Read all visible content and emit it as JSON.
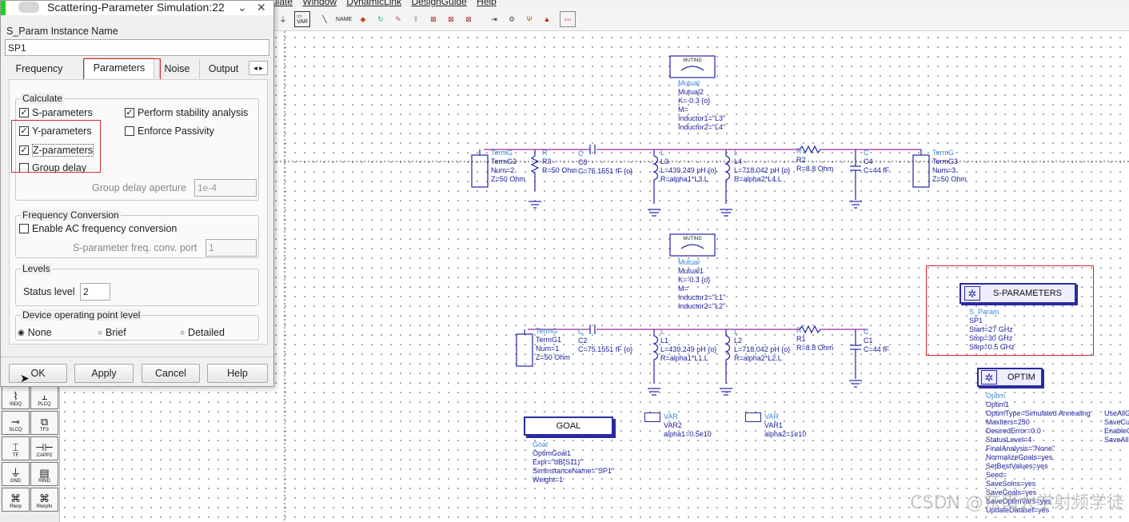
{
  "menubar": {
    "items": [
      "ulate",
      "Window",
      "DynamicLink",
      "DesignGuide",
      "Help"
    ]
  },
  "dialog": {
    "title": "Scattering-Parameter Simulation:22",
    "instance_label": "S_Param Instance Name",
    "instance_value": "SP1",
    "tabs": [
      "Frequency",
      "Parameters",
      "Noise",
      "Output"
    ],
    "calculate": {
      "legend": "Calculate",
      "s_params": "S-parameters",
      "y_params": "Y-parameters",
      "z_params": "Z-parameters",
      "group_delay": "Group delay",
      "stability": "Perform stability analysis",
      "passivity": "Enforce Passivity",
      "gd_aperture_label": "Group delay aperture",
      "gd_aperture_value": "1e-4"
    },
    "freq_conv": {
      "legend": "Frequency Conversion",
      "enable": "Enable AC frequency conversion",
      "port_label": "S-parameter freq. conv. port",
      "port_value": "1"
    },
    "levels": {
      "legend": "Levels",
      "status_label": "Status level",
      "status_value": "2"
    },
    "devop": {
      "legend": "Device operating point level",
      "none": "None",
      "brief": "Brief",
      "detailed": "Detailed"
    },
    "buttons": {
      "ok": "OK",
      "apply": "Apply",
      "cancel": "Cancel",
      "help": "Help"
    }
  },
  "palette": [
    "INDQ",
    "PLCQ",
    "SLCQ",
    "TF3",
    "TF",
    "CAPP2",
    "GND",
    "RIND",
    "Rterp",
    "Rterpfn"
  ],
  "schematic": {
    "mutual2": [
      "MUTIND",
      "Mutual",
      "Mutual2",
      "K=-0.3 {o}",
      "M=",
      "Inductor1=\"L3\"",
      "Inductor2=\"L4\""
    ],
    "mutual1": [
      "MUTIND",
      "Mutual",
      "Mutual1",
      "K=-0.3 {o}",
      "M=",
      "Inductor1=\"L1\"",
      "Inductor2=\"L2\""
    ],
    "termg2": [
      "TermG",
      "TermG2",
      "Num=2",
      "Z=50 Ohm"
    ],
    "termg3": [
      "TermG",
      "TermG3",
      "Num=3",
      "Z=50 Ohm"
    ],
    "termg1": [
      "TermG",
      "TermG1",
      "Num=1",
      "Z=50 Ohm"
    ],
    "r3": [
      "R",
      "R3",
      "R=50 Ohm"
    ],
    "c3": [
      "C",
      "C3",
      "C=75.1551 fF {o}"
    ],
    "c2": [
      "C",
      "C2",
      "C=75.1551 fF {o}"
    ],
    "l3": [
      "L",
      "L3",
      "L=439.249 pH {o}",
      "R=alpha1*L3.L"
    ],
    "l4": [
      "L",
      "L4",
      "L=718.042 pH {o}",
      "R=alpha2*L4.L"
    ],
    "l1": [
      "L",
      "L1",
      "L=439.249 pH {o}",
      "R=alpha1*L1.L"
    ],
    "l2": [
      "L",
      "L2",
      "L=718.042 pH {o}",
      "R=alpha2*L2.L"
    ],
    "r2": [
      "R",
      "R2",
      "R=8.8 Ohm"
    ],
    "r1": [
      "R",
      "R1",
      "R=8.8 Ohm"
    ],
    "c4": [
      "C",
      "C4",
      "C=44 fF"
    ],
    "c1": [
      "C",
      "C1",
      "C=44 fF"
    ],
    "sparam": {
      "title": "S-PARAMETERS",
      "lines": [
        "S_Param",
        "SP1",
        "Start=27 GHz",
        "Stop=30 GHz",
        "Step=0.5 GHz"
      ]
    },
    "optim": {
      "title": "OPTIM",
      "lines": [
        "Optim",
        "Optim1",
        "OptimType=Simulated Annealing",
        "MaxIters=250",
        "DesiredError=0.0",
        "StatusLevel=4",
        "FinalAnalysis=\"None\"",
        "NormalizeGoals=yes",
        "SetBestValues=yes",
        "Seed=",
        "SaveSolns=yes",
        "SaveGoals=yes",
        "SaveOptimVars=yes",
        "UpdateDataset=yes"
      ],
      "extra": [
        "UseAllG",
        "SaveCu",
        "EnableC",
        "SaveAll"
      ]
    },
    "goal": {
      "title": "GOAL",
      "lines": [
        "Goal",
        "OptimGoal1",
        "Expr=\"dB(S11)\"",
        "SimInstanceName=\"SP1\"",
        "Weight=1"
      ]
    },
    "var2": {
      "title": "VAR",
      "lines": [
        "VAR2",
        "alpha1=0.5e10"
      ]
    },
    "var1": {
      "title": "VAR",
      "lines": [
        "VAR1",
        "alpha2=1e10"
      ]
    }
  },
  "watermark": "CSDN @东南大学射频学徒"
}
